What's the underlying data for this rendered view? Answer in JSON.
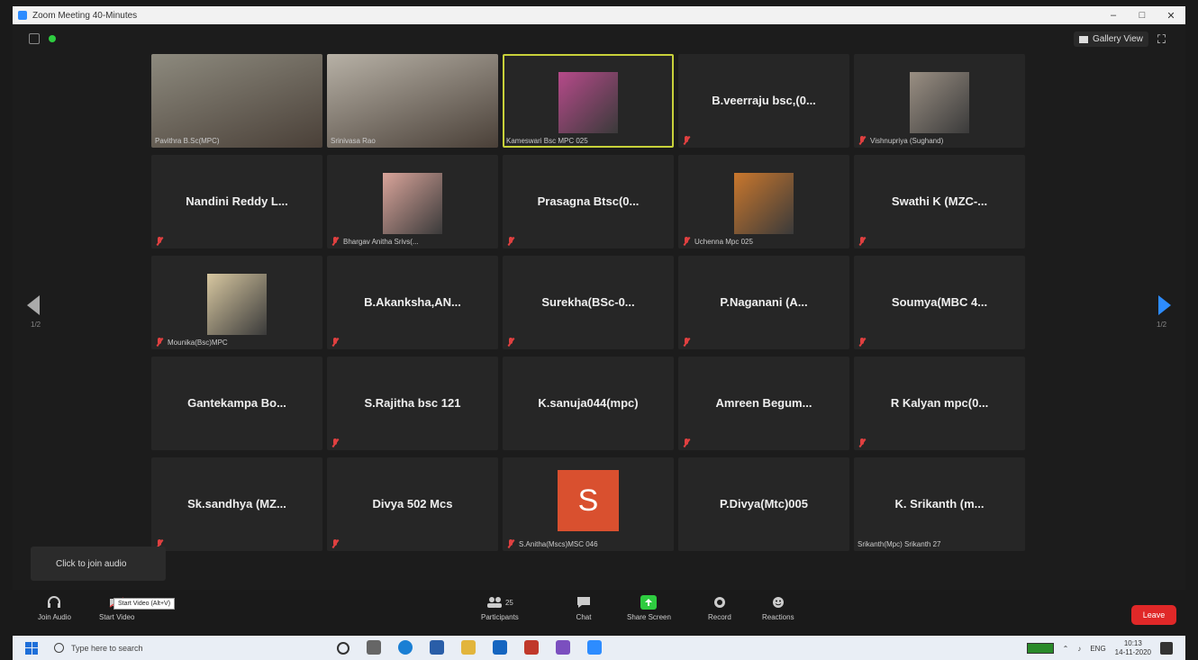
{
  "window": {
    "title": "Zoom Meeting 40-Minutes",
    "min": "–",
    "max": "□",
    "close": "✕"
  },
  "header": {
    "gallery_view_label": "Gallery View",
    "fullscreen_icon": "⛶"
  },
  "pagination": {
    "left_page": "1/2",
    "right_page": "1/2"
  },
  "tiles": [
    {
      "type": "video",
      "small": "Pavithra B.Sc(MPC)",
      "muted": false,
      "bg": "#8d8a7e"
    },
    {
      "type": "video",
      "small": "Srinivasa Rao",
      "muted": false,
      "bg": "#b7b1a6"
    },
    {
      "type": "photo",
      "small": "Kameswari Bsc MPC 025",
      "muted": false,
      "active": true,
      "photo": "#b64a8a"
    },
    {
      "type": "name",
      "big": "B.veerraju bsc,(0...",
      "muted": true
    },
    {
      "type": "photo",
      "small": "Vishnupriya (Sughand)",
      "muted": true,
      "photo": "#9a8f83"
    },
    {
      "type": "name",
      "big": "Nandini Reddy L...",
      "muted": true
    },
    {
      "type": "photo",
      "small": "Bhargav Anitha Srivs(...",
      "muted": true,
      "photo": "#d9a49a"
    },
    {
      "type": "name",
      "big": "Prasagna Btsc(0...",
      "muted": true
    },
    {
      "type": "photo",
      "small": "Uchenna Mpc 025",
      "muted": true,
      "photo": "#c9772d"
    },
    {
      "type": "name",
      "big": "Swathi K (MZC-...",
      "muted": true
    },
    {
      "type": "photo",
      "small": "Mounika(Bsc)MPC",
      "muted": true,
      "photo": "#d7c7a0"
    },
    {
      "type": "name",
      "big": "B.Akanksha,AN...",
      "muted": true
    },
    {
      "type": "name",
      "big": "Surekha(BSc-0...",
      "muted": true
    },
    {
      "type": "name",
      "big": "P.Naganani (A...",
      "muted": true
    },
    {
      "type": "name",
      "big": "Soumya(MBC 4...",
      "muted": true
    },
    {
      "type": "name",
      "big": "Gantekampa Bo...",
      "muted": false
    },
    {
      "type": "name",
      "big": "S.Rajitha bsc 121",
      "muted": true
    },
    {
      "type": "name",
      "big": "K.sanuja044(mpc)",
      "muted": false
    },
    {
      "type": "name",
      "big": "Amreen Begum...",
      "muted": true
    },
    {
      "type": "name",
      "big": "R Kalyan mpc(0...",
      "muted": true
    },
    {
      "type": "name",
      "big": "Sk.sandhya (MZ...",
      "muted": true
    },
    {
      "type": "name",
      "big": "Divya 502 Mcs",
      "muted": true
    },
    {
      "type": "letter",
      "letter": "S",
      "small": "S.Anitha(Mscs)MSC 046",
      "muted": true
    },
    {
      "type": "name",
      "big": "P.Divya(Mtc)005",
      "muted": false
    },
    {
      "type": "name",
      "big": "K. Srikanth (m...",
      "small": "Srikanth(Mpc) Srikanth 27",
      "muted": false
    }
  ],
  "toast": {
    "text": "Click to join audio"
  },
  "toolbar": {
    "join_audio": "Join Audio",
    "start_video": "Start Video",
    "tooltip": "Start Video (Alt+V)",
    "participants": "Participants",
    "participants_count": "25",
    "chat": "Chat",
    "share_screen": "Share Screen",
    "record": "Record",
    "reactions": "Reactions",
    "leave": "Leave"
  },
  "taskbar": {
    "search_placeholder": "Type here to search",
    "lang": "ENG",
    "time": "10:13",
    "date": "14-11-2020"
  }
}
